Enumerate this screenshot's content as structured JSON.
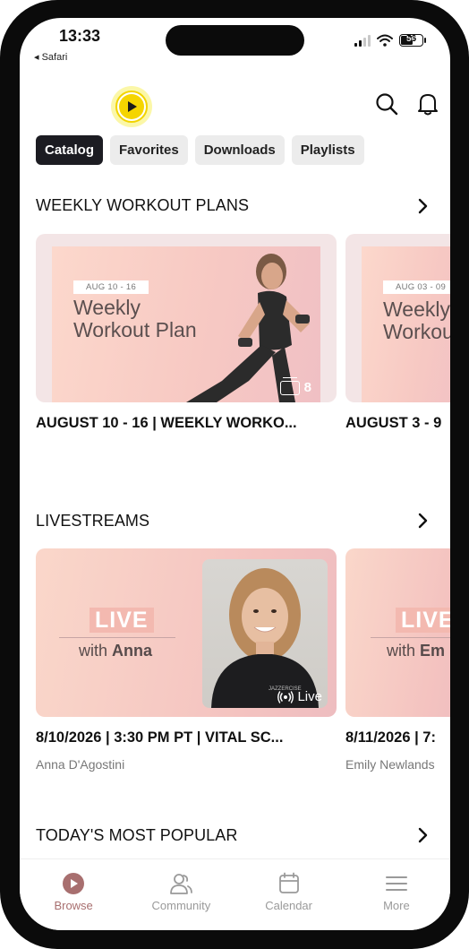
{
  "status_bar": {
    "time": "13:33",
    "back_app": "◂ Safari",
    "battery_level": "56"
  },
  "header": {
    "logo": "app-logo-play",
    "icons": [
      "search-icon",
      "bell-icon"
    ]
  },
  "tabs": [
    {
      "label": "Catalog",
      "active": true
    },
    {
      "label": "Favorites",
      "active": false
    },
    {
      "label": "Downloads",
      "active": false
    },
    {
      "label": "Playlists",
      "active": false
    }
  ],
  "weekly": {
    "title": "WEEKLY WORKOUT PLANS",
    "cards": [
      {
        "date": "AUG 10 - 16",
        "line1": "Weekly",
        "line2": "Workout Plan",
        "count": "8",
        "caption": "AUGUST 10 -  16 | WEEKLY WORKO..."
      },
      {
        "date": "AUG 03 - 09",
        "line1": "Weekly",
        "line2": "Workou",
        "caption": "AUGUST 3 -  9"
      }
    ]
  },
  "livestreams": {
    "title": "LIVESTREAMS",
    "cards": [
      {
        "live_word": "LIVE",
        "with_prefix": "with",
        "host_first": "Anna",
        "badge": "Live",
        "shirt_text": "JAZZERCISE",
        "caption": "8/10/2026 | 3:30 PM PT | VITAL SC...",
        "host": "Anna D'Agostini"
      },
      {
        "live_word": "LIVE",
        "with_prefix": "with",
        "host_first": "Em",
        "caption": "8/11/2026 | 7:",
        "host": "Emily Newlands"
      }
    ]
  },
  "popular": {
    "title": "TODAY'S MOST POPULAR"
  },
  "bottom_nav": [
    {
      "label": "Browse",
      "icon": "play-circle-icon",
      "active": true
    },
    {
      "label": "Community",
      "icon": "people-icon",
      "active": false
    },
    {
      "label": "Calendar",
      "icon": "calendar-icon",
      "active": false
    },
    {
      "label": "More",
      "icon": "menu-icon",
      "active": false
    }
  ],
  "colors": {
    "accent": "#a86f6f",
    "tab_active": "#1c1c22",
    "logo_yellow": "#f5d500",
    "card_bg": "#f3e5e6"
  }
}
